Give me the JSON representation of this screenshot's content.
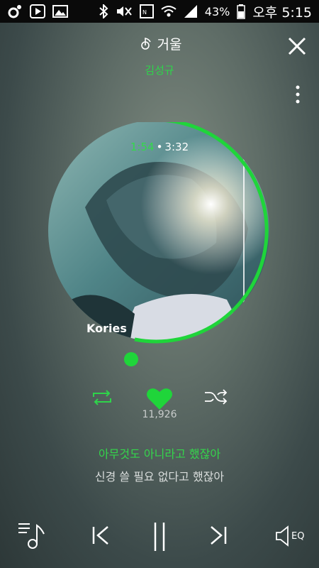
{
  "status_bar": {
    "battery": "43%",
    "time": "오후 5:15"
  },
  "song": {
    "title": "거울",
    "artist": "김성규"
  },
  "playback": {
    "elapsed": "1:54",
    "separator": "•",
    "total": "3:32",
    "progress_fraction": 0.54
  },
  "album_art": {
    "caption": "Kories"
  },
  "like_count": "11,926",
  "lyrics": {
    "current": "아무것도 아니라고 했잖아",
    "next": "신경 쓸 필요 없다고 했잖아"
  },
  "controls": {
    "eq_label": "EQ"
  },
  "colors": {
    "accent": "#2ed44a",
    "statusbar": "#0a0a0a"
  }
}
